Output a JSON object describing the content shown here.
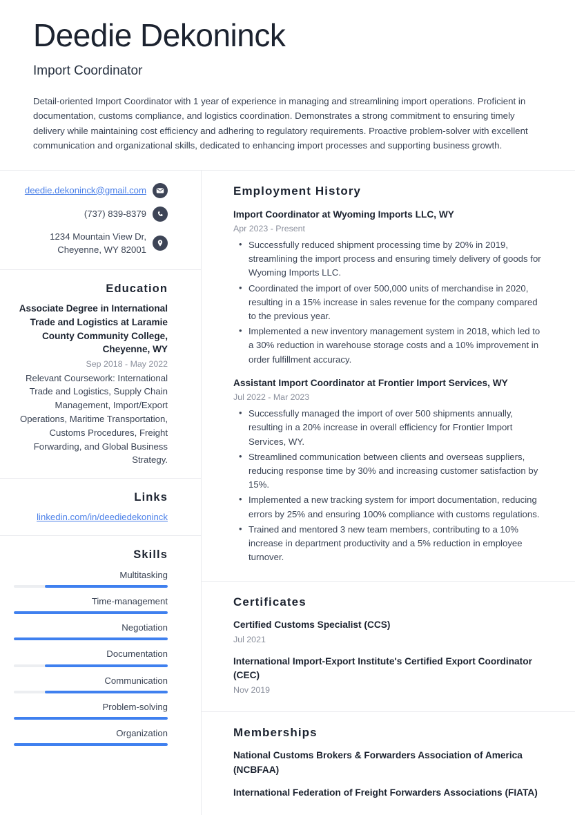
{
  "header": {
    "name": "Deedie Dekoninck",
    "role": "Import Coordinator",
    "summary": "Detail-oriented Import Coordinator with 1 year of experience in managing and streamlining import operations. Proficient in documentation, customs compliance, and logistics coordination. Demonstrates a strong commitment to ensuring timely delivery while maintaining cost efficiency and adhering to regulatory requirements. Proactive problem-solver with excellent communication and organizational skills, dedicated to enhancing import processes and supporting business growth."
  },
  "contact": {
    "email": "deedie.dekoninck@gmail.com",
    "phone": "(737) 839-8379",
    "address_line1": "1234 Mountain View Dr,",
    "address_line2": "Cheyenne, WY 82001",
    "icons": {
      "email": "envelope-icon",
      "phone": "phone-icon",
      "address": "location-pin-icon"
    }
  },
  "education": {
    "heading": "Education",
    "entries": [
      {
        "title": "Associate Degree in International Trade and Logistics at Laramie County Community College, Cheyenne, WY",
        "date": "Sep 2018 - May 2022",
        "description": "Relevant Coursework: International Trade and Logistics, Supply Chain Management, Import/Export Operations, Maritime Transportation, Customs Procedures, Freight Forwarding, and Global Business Strategy."
      }
    ]
  },
  "links": {
    "heading": "Links",
    "items": [
      {
        "label": "linkedin.com/in/deediedekoninck"
      }
    ]
  },
  "skills": {
    "heading": "Skills",
    "accent_color": "#3f80ef",
    "track_color": "#eceef1",
    "items": [
      {
        "name": "Multitasking",
        "level": 80
      },
      {
        "name": "Time-management",
        "level": 100
      },
      {
        "name": "Negotiation",
        "level": 100
      },
      {
        "name": "Documentation",
        "level": 80
      },
      {
        "name": "Communication",
        "level": 80
      },
      {
        "name": "Problem-solving",
        "level": 100
      },
      {
        "name": "Organization",
        "level": 100
      }
    ]
  },
  "employment": {
    "heading": "Employment History",
    "jobs": [
      {
        "title": "Import Coordinator at Wyoming Imports LLC, WY",
        "date": "Apr 2023 - Present",
        "bullets": [
          "Successfully reduced shipment processing time by 20% in 2019, streamlining the import process and ensuring timely delivery of goods for Wyoming Imports LLC.",
          "Coordinated the import of over 500,000 units of merchandise in 2020, resulting in a 15% increase in sales revenue for the company compared to the previous year.",
          "Implemented a new inventory management system in 2018, which led to a 30% reduction in warehouse storage costs and a 10% improvement in order fulfillment accuracy."
        ]
      },
      {
        "title": "Assistant Import Coordinator at Frontier Import Services, WY",
        "date": "Jul 2022 - Mar 2023",
        "bullets": [
          "Successfully managed the import of over 500 shipments annually, resulting in a 20% increase in overall efficiency for Frontier Import Services, WY.",
          "Streamlined communication between clients and overseas suppliers, reducing response time by 30% and increasing customer satisfaction by 15%.",
          "Implemented a new tracking system for import documentation, reducing errors by 25% and ensuring 100% compliance with customs regulations.",
          "Trained and mentored 3 new team members, contributing to a 10% increase in department productivity and a 5% reduction in employee turnover."
        ]
      }
    ]
  },
  "certificates": {
    "heading": "Certificates",
    "items": [
      {
        "title": "Certified Customs Specialist (CCS)",
        "date": "Jul 2021"
      },
      {
        "title": "International Import-Export Institute's Certified Export Coordinator (CEC)",
        "date": "Nov 2019"
      }
    ]
  },
  "memberships": {
    "heading": "Memberships",
    "items": [
      {
        "title": "National Customs Brokers & Forwarders Association of America (NCBFAA)"
      },
      {
        "title": "International Federation of Freight Forwarders Associations (FIATA)"
      }
    ]
  }
}
